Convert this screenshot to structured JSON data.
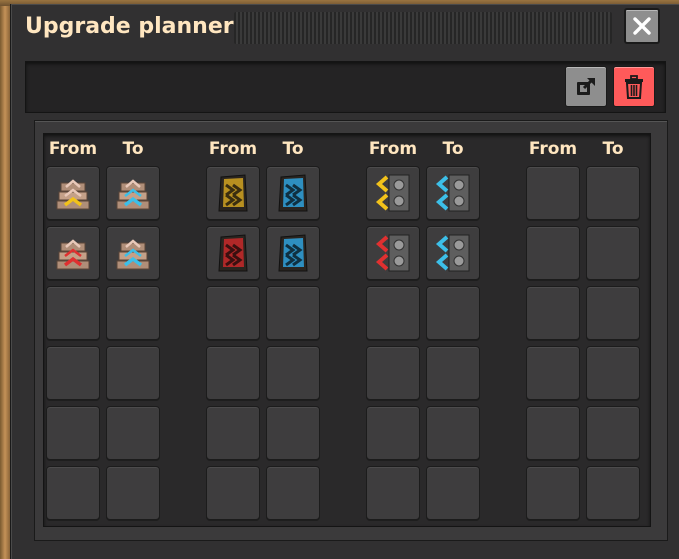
{
  "window": {
    "title": "Upgrade planner"
  },
  "toolbar": {
    "export_icon": "export-icon",
    "delete_icon": "trash-icon"
  },
  "columns": [
    {
      "from_label": "From",
      "to_label": "To"
    },
    {
      "from_label": "From",
      "to_label": "To"
    },
    {
      "from_label": "From",
      "to_label": "To"
    },
    {
      "from_label": "From",
      "to_label": "To"
    }
  ],
  "mappings": [
    {
      "from": "fast-transport-belt",
      "to": "express-transport-belt"
    },
    {
      "from": "transport-belt",
      "to": "express-transport-belt"
    },
    {
      "from": "fast-underground-belt",
      "to": "express-underground-belt"
    },
    {
      "from": "underground-belt",
      "to": "express-underground-belt"
    },
    {
      "from": "fast-splitter",
      "to": "express-splitter"
    },
    {
      "from": "splitter",
      "to": "express-splitter"
    }
  ],
  "colors": {
    "accent_title": "#ffe6c0",
    "delete_red": "#ff5a5a",
    "tier_yellow": "#f2c21a",
    "tier_red": "#e03030",
    "tier_blue": "#3cbfe8"
  }
}
